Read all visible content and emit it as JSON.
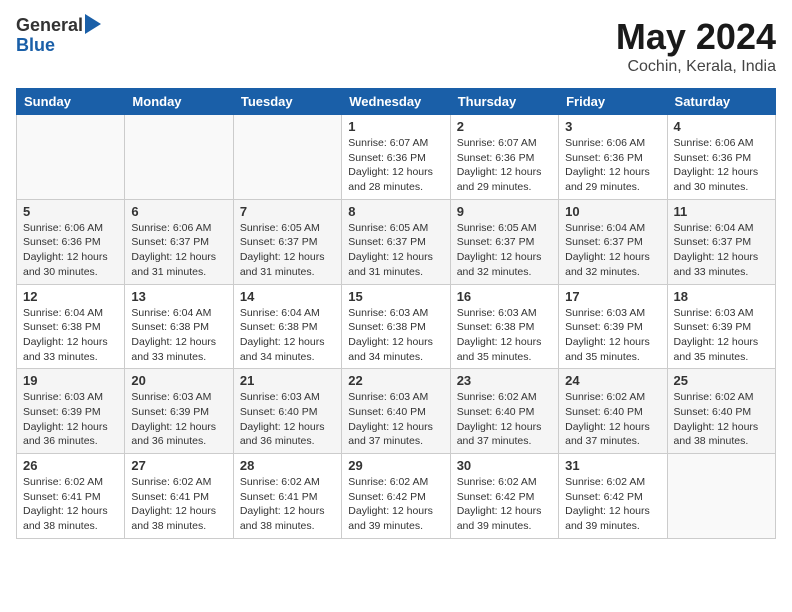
{
  "header": {
    "logo_general": "General",
    "logo_blue": "Blue",
    "title": "May 2024",
    "subtitle": "Cochin, Kerala, India"
  },
  "weekdays": [
    "Sunday",
    "Monday",
    "Tuesday",
    "Wednesday",
    "Thursday",
    "Friday",
    "Saturday"
  ],
  "weeks": [
    [
      {
        "day": "",
        "info": ""
      },
      {
        "day": "",
        "info": ""
      },
      {
        "day": "",
        "info": ""
      },
      {
        "day": "1",
        "info": "Sunrise: 6:07 AM\nSunset: 6:36 PM\nDaylight: 12 hours\nand 28 minutes."
      },
      {
        "day": "2",
        "info": "Sunrise: 6:07 AM\nSunset: 6:36 PM\nDaylight: 12 hours\nand 29 minutes."
      },
      {
        "day": "3",
        "info": "Sunrise: 6:06 AM\nSunset: 6:36 PM\nDaylight: 12 hours\nand 29 minutes."
      },
      {
        "day": "4",
        "info": "Sunrise: 6:06 AM\nSunset: 6:36 PM\nDaylight: 12 hours\nand 30 minutes."
      }
    ],
    [
      {
        "day": "5",
        "info": "Sunrise: 6:06 AM\nSunset: 6:36 PM\nDaylight: 12 hours\nand 30 minutes."
      },
      {
        "day": "6",
        "info": "Sunrise: 6:06 AM\nSunset: 6:37 PM\nDaylight: 12 hours\nand 31 minutes."
      },
      {
        "day": "7",
        "info": "Sunrise: 6:05 AM\nSunset: 6:37 PM\nDaylight: 12 hours\nand 31 minutes."
      },
      {
        "day": "8",
        "info": "Sunrise: 6:05 AM\nSunset: 6:37 PM\nDaylight: 12 hours\nand 31 minutes."
      },
      {
        "day": "9",
        "info": "Sunrise: 6:05 AM\nSunset: 6:37 PM\nDaylight: 12 hours\nand 32 minutes."
      },
      {
        "day": "10",
        "info": "Sunrise: 6:04 AM\nSunset: 6:37 PM\nDaylight: 12 hours\nand 32 minutes."
      },
      {
        "day": "11",
        "info": "Sunrise: 6:04 AM\nSunset: 6:37 PM\nDaylight: 12 hours\nand 33 minutes."
      }
    ],
    [
      {
        "day": "12",
        "info": "Sunrise: 6:04 AM\nSunset: 6:38 PM\nDaylight: 12 hours\nand 33 minutes."
      },
      {
        "day": "13",
        "info": "Sunrise: 6:04 AM\nSunset: 6:38 PM\nDaylight: 12 hours\nand 33 minutes."
      },
      {
        "day": "14",
        "info": "Sunrise: 6:04 AM\nSunset: 6:38 PM\nDaylight: 12 hours\nand 34 minutes."
      },
      {
        "day": "15",
        "info": "Sunrise: 6:03 AM\nSunset: 6:38 PM\nDaylight: 12 hours\nand 34 minutes."
      },
      {
        "day": "16",
        "info": "Sunrise: 6:03 AM\nSunset: 6:38 PM\nDaylight: 12 hours\nand 35 minutes."
      },
      {
        "day": "17",
        "info": "Sunrise: 6:03 AM\nSunset: 6:39 PM\nDaylight: 12 hours\nand 35 minutes."
      },
      {
        "day": "18",
        "info": "Sunrise: 6:03 AM\nSunset: 6:39 PM\nDaylight: 12 hours\nand 35 minutes."
      }
    ],
    [
      {
        "day": "19",
        "info": "Sunrise: 6:03 AM\nSunset: 6:39 PM\nDaylight: 12 hours\nand 36 minutes."
      },
      {
        "day": "20",
        "info": "Sunrise: 6:03 AM\nSunset: 6:39 PM\nDaylight: 12 hours\nand 36 minutes."
      },
      {
        "day": "21",
        "info": "Sunrise: 6:03 AM\nSunset: 6:40 PM\nDaylight: 12 hours\nand 36 minutes."
      },
      {
        "day": "22",
        "info": "Sunrise: 6:03 AM\nSunset: 6:40 PM\nDaylight: 12 hours\nand 37 minutes."
      },
      {
        "day": "23",
        "info": "Sunrise: 6:02 AM\nSunset: 6:40 PM\nDaylight: 12 hours\nand 37 minutes."
      },
      {
        "day": "24",
        "info": "Sunrise: 6:02 AM\nSunset: 6:40 PM\nDaylight: 12 hours\nand 37 minutes."
      },
      {
        "day": "25",
        "info": "Sunrise: 6:02 AM\nSunset: 6:40 PM\nDaylight: 12 hours\nand 38 minutes."
      }
    ],
    [
      {
        "day": "26",
        "info": "Sunrise: 6:02 AM\nSunset: 6:41 PM\nDaylight: 12 hours\nand 38 minutes."
      },
      {
        "day": "27",
        "info": "Sunrise: 6:02 AM\nSunset: 6:41 PM\nDaylight: 12 hours\nand 38 minutes."
      },
      {
        "day": "28",
        "info": "Sunrise: 6:02 AM\nSunset: 6:41 PM\nDaylight: 12 hours\nand 38 minutes."
      },
      {
        "day": "29",
        "info": "Sunrise: 6:02 AM\nSunset: 6:42 PM\nDaylight: 12 hours\nand 39 minutes."
      },
      {
        "day": "30",
        "info": "Sunrise: 6:02 AM\nSunset: 6:42 PM\nDaylight: 12 hours\nand 39 minutes."
      },
      {
        "day": "31",
        "info": "Sunrise: 6:02 AM\nSunset: 6:42 PM\nDaylight: 12 hours\nand 39 minutes."
      },
      {
        "day": "",
        "info": ""
      }
    ]
  ]
}
